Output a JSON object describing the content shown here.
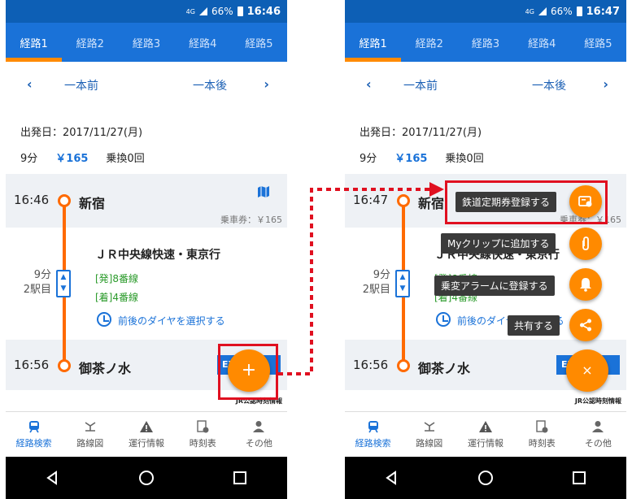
{
  "status_bar": {
    "left": {
      "network": "4G",
      "battery": "66%",
      "time": "16:46"
    },
    "right": {
      "network": "4G",
      "battery": "66%",
      "time": "16:47"
    }
  },
  "tabs": [
    "経路1",
    "経路2",
    "経路3",
    "経路4",
    "経路5"
  ],
  "nav": {
    "prev": "一本前",
    "next": "一本後",
    "prev_chevron": "‹",
    "next_chevron": "›"
  },
  "summary": {
    "date": "出発日：2017/11/27(月)",
    "duration": "9分",
    "fare": "￥165",
    "transfers": "乗換0回"
  },
  "route": {
    "from": {
      "time_left": "16:46",
      "time_right": "16:47",
      "station": "新宿",
      "ticket": "乗車券：￥165"
    },
    "line": "ＪＲ中央線快速・東京行",
    "segment": {
      "duration": "9分",
      "stops": "2駅目"
    },
    "platform_dep": "[発]8番線",
    "platform_arr": "[着]4番線",
    "choose_schedule": "前後のダイヤを選択する",
    "to": {
      "time": "16:56",
      "station": "御茶ノ水"
    },
    "badge": "EX",
    "provider": "JR公認時刻情報"
  },
  "fab": {
    "open_symbol": "+",
    "close_symbol": "×"
  },
  "fab_menu": [
    {
      "label": "鉄道定期券登録する",
      "icon": "commuter-pass-icon"
    },
    {
      "label": "Myクリップに追加する",
      "icon": "paperclip-icon"
    },
    {
      "label": "乗変アラームに登録する",
      "icon": "bell-icon"
    },
    {
      "label": "共有する",
      "icon": "share-icon"
    }
  ],
  "bottom_nav": [
    "経路検索",
    "路線図",
    "運行情報",
    "時刻表",
    "その他"
  ],
  "colors": {
    "primary": "#1a72d8",
    "accent": "#ff8a00",
    "route": "#ff6a00",
    "highlight": "#e01020"
  }
}
